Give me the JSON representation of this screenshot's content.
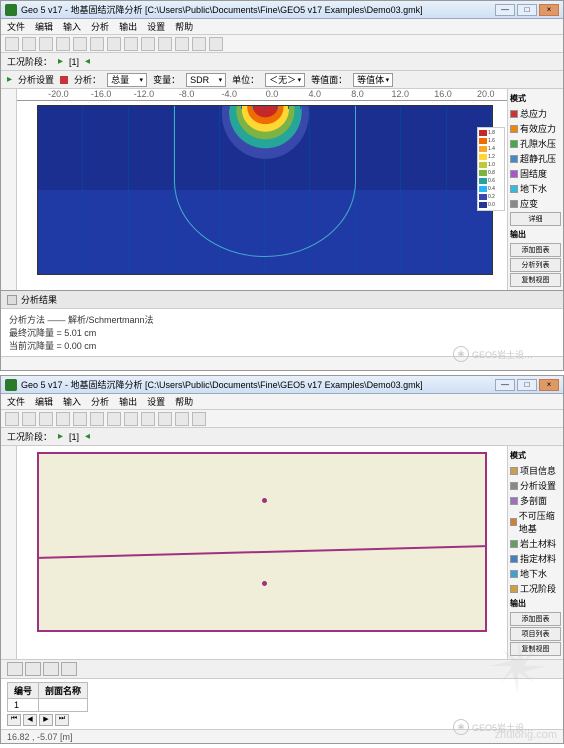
{
  "app": {
    "title_prefix": "Geo 5 v17 - 地基固结沉降分析",
    "title_path": "[C:\\Users\\Public\\Documents\\Fine\\GEO5 v17 Examples\\Demo03.gmk]",
    "win_min": "—",
    "win_max": "□",
    "win_close": "×"
  },
  "menu": [
    "文件",
    "编辑",
    "输入",
    "分析",
    "输出",
    "设置",
    "帮助"
  ],
  "subbar1": {
    "stage_label": "工况阶段：",
    "play": "▸",
    "n1": "[1]",
    "analysis_btn": "分析设置",
    "record": "■",
    "param_lbl": "分析：",
    "param_val": "总量",
    "var_lbl": "变量：",
    "var_val": "SDR",
    "unit_lbl": "单位：",
    "unit_val": "＜无＞",
    "stress_lbl": "等值面：",
    "stress_val": "等值体"
  },
  "ruler_ticks": [
    "-20.0",
    "-16.0",
    "-12.0",
    "-8.0",
    "-4.0",
    "0.0",
    "4.0",
    "8.0",
    "12.0",
    "16.0",
    "20.0"
  ],
  "contour_colors": [
    "#c62828",
    "#ef6c00",
    "#fdd835",
    "#7cb342",
    "#26a69a",
    "#29b6f6",
    "#3949ab"
  ],
  "legend1": [
    {
      "c": "#c62828",
      "v": "1.8"
    },
    {
      "c": "#ef6c00",
      "v": "1.6"
    },
    {
      "c": "#f9a825",
      "v": "1.4"
    },
    {
      "c": "#fdd835",
      "v": "1.2"
    },
    {
      "c": "#c0ca33",
      "v": "1.0"
    },
    {
      "c": "#7cb342",
      "v": "0.8"
    },
    {
      "c": "#26a69a",
      "v": "0.6"
    },
    {
      "c": "#29b6f6",
      "v": "0.4"
    },
    {
      "c": "#3949ab",
      "v": "0.2"
    },
    {
      "c": "#283593",
      "v": "0.0"
    }
  ],
  "side1": {
    "hdr": "模式",
    "items": [
      "总应力",
      "有效应力",
      "孔隙水压",
      "超静孔压",
      "固结度",
      "地下水",
      "应变"
    ],
    "btn_detail": "详细",
    "sect2": "输出",
    "btn_add": "添加图表",
    "btn_list": "分析列表",
    "btn_copy": "复制视图"
  },
  "bp1": {
    "tab": "分析结果",
    "l1": "分析方法 —— 解析/Schmertmann法",
    "l2": "最终沉降量 = 5.01 cm",
    "l3": "当前沉降量 = 0.00 cm"
  },
  "side2": {
    "hdr": "模式",
    "items": [
      {
        "ic": "#c8a050",
        "t": "项目信息"
      },
      {
        "ic": "#888",
        "t": "分析设置"
      },
      {
        "ic": "#a070c0",
        "t": "多剖面"
      },
      {
        "ic": "#d08030",
        "t": "不可压缩地基"
      },
      {
        "ic": "#60a060",
        "t": "岩土材料"
      },
      {
        "ic": "#4080c0",
        "t": "指定材料"
      },
      {
        "ic": "#40a0d0",
        "t": "地下水"
      },
      {
        "ic": "#d0a040",
        "t": "工况阶段"
      }
    ],
    "sect2": "输出",
    "btn_add": "添加图表",
    "btn_list": "项目列表",
    "btn_copy": "复制视图"
  },
  "table2": {
    "h1": "编号",
    "h2": "剖面名称",
    "r1c1": "1",
    "r1c2": " "
  },
  "status2": "16.82 , -5.07 [m]",
  "watermark": "GEO5岩土设…",
  "footer_wm": "zhulong.com"
}
